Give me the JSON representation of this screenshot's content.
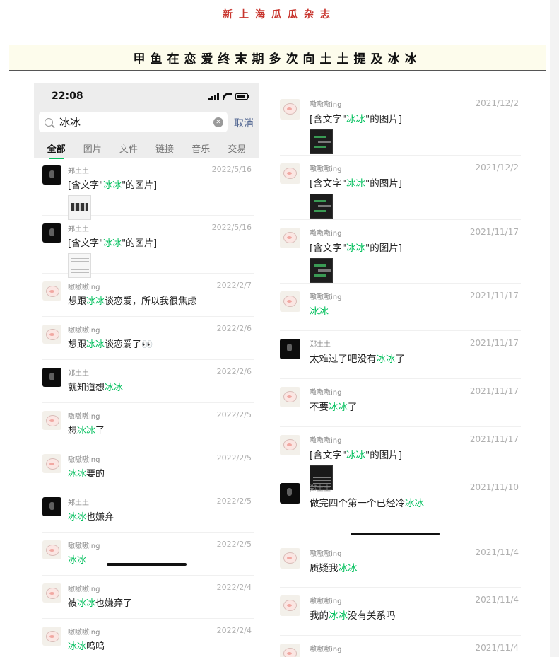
{
  "magazine": {
    "title": "新上海瓜瓜杂志",
    "headline": "甲鱼在恋爱终末期多次向土土提及冰冰"
  },
  "status_bar": {
    "time": "22:08"
  },
  "search": {
    "query": "冰冰",
    "cancel_label": "取消"
  },
  "tabs": [
    {
      "label": "全部",
      "active": true
    },
    {
      "label": "图片",
      "active": false
    },
    {
      "label": "文件",
      "active": false
    },
    {
      "label": "链接",
      "active": false
    },
    {
      "label": "音乐",
      "active": false
    },
    {
      "label": "交易",
      "active": false
    }
  ],
  "left_results": [
    {
      "sender": "郑土土",
      "date": "2022/5/16",
      "avatar": "dark",
      "parts": [
        "[含文字\"",
        "冰冰",
        "\"的图片]"
      ],
      "thumb": "light"
    },
    {
      "sender": "郑土土",
      "date": "2022/5/16",
      "avatar": "dark",
      "parts": [
        "[含文字\"",
        "冰冰",
        "\"的图片]"
      ],
      "thumb": "doc"
    },
    {
      "sender": "嗷嗷嗷ing",
      "date": "2022/2/7",
      "avatar": "pig",
      "parts": [
        "想跟",
        "冰冰",
        "谈恋爱，所以我很焦虑"
      ]
    },
    {
      "sender": "嗷嗷嗷ing",
      "date": "2022/2/6",
      "avatar": "pig",
      "parts": [
        "想跟",
        "冰冰",
        "谈恋爱了👀"
      ]
    },
    {
      "sender": "郑土土",
      "date": "2022/2/6",
      "avatar": "dark",
      "parts": [
        "就知道想",
        "冰冰",
        ""
      ]
    },
    {
      "sender": "嗷嗷嗷ing",
      "date": "2022/2/5",
      "avatar": "pig",
      "parts": [
        "想",
        "冰冰",
        "了"
      ]
    },
    {
      "sender": "嗷嗷嗷ing",
      "date": "2022/2/5",
      "avatar": "pig",
      "parts": [
        "",
        "冰冰",
        "要的"
      ]
    },
    {
      "sender": "郑土土",
      "date": "2022/2/5",
      "avatar": "dark",
      "parts": [
        "",
        "冰冰",
        "也嫌弃"
      ]
    },
    {
      "sender": "嗷嗷嗷ing",
      "date": "2022/2/5",
      "avatar": "pig",
      "parts": [
        "",
        "冰冰",
        ""
      ]
    },
    {
      "sender": "嗷嗷嗷ing",
      "date": "2022/2/4",
      "avatar": "pig",
      "parts": [
        "被",
        "冰冰",
        "也嫌弃了"
      ]
    },
    {
      "sender": "嗷嗷嗷ing",
      "date": "2022/2/4",
      "avatar": "pig",
      "parts": [
        "",
        "冰冰",
        "呜呜"
      ]
    }
  ],
  "right_results": [
    {
      "sender": "嗷嗷嗷ing",
      "date": "2021/12/2",
      "avatar": "pig",
      "parts": [
        "[含文字\"",
        "冰冰",
        "\"的图片]"
      ],
      "thumb": "darkchat"
    },
    {
      "sender": "嗷嗷嗷ing",
      "date": "2021/12/2",
      "avatar": "pig",
      "parts": [
        "[含文字\"",
        "冰冰",
        "\"的图片]"
      ],
      "thumb": "darkchat"
    },
    {
      "sender": "嗷嗷嗷ing",
      "date": "2021/11/17",
      "avatar": "pig",
      "parts": [
        "[含文字\"",
        "冰冰",
        "\"的图片]"
      ],
      "thumb": "darkchat"
    },
    {
      "sender": "嗷嗷嗷ing",
      "date": "2021/11/17",
      "avatar": "pig",
      "parts": [
        "",
        "冰冰",
        ""
      ]
    },
    {
      "sender": "郑土土",
      "date": "2021/11/17",
      "avatar": "dark",
      "parts": [
        "太难过了吧没有",
        "冰冰",
        "了"
      ]
    },
    {
      "sender": "嗷嗷嗷ing",
      "date": "2021/11/17",
      "avatar": "pig",
      "parts": [
        "不要",
        "冰冰",
        "了"
      ]
    },
    {
      "sender": "嗷嗷嗷ing",
      "date": "2021/11/17",
      "avatar": "pig",
      "parts": [
        "[含文字\"",
        "冰冰",
        "\"的图片]"
      ],
      "thumb": "darktext"
    },
    {
      "sender": "郑土土",
      "date": "2021/11/10",
      "avatar": "dark",
      "parts": [
        "做完四个第一个已经冷",
        "冰冰",
        ""
      ]
    },
    {
      "sender": "嗷嗷嗷ing",
      "date": "2021/11/4",
      "avatar": "pig",
      "parts": [
        "质疑我",
        "冰冰",
        ""
      ]
    },
    {
      "sender": "嗷嗷嗷ing",
      "date": "2021/11/4",
      "avatar": "pig",
      "parts": [
        "我的",
        "冰冰",
        "没有关系吗"
      ]
    },
    {
      "sender": "嗷嗷嗷ing",
      "date": "2021/11/4",
      "avatar": "pig",
      "parts": [
        "",
        "",
        ""
      ]
    }
  ],
  "colors": {
    "highlight": "#07c160",
    "cancel": "#576b95",
    "title_red": "#c8352e",
    "headline_bg": "#fdfcec"
  },
  "icons": {
    "search": "search-icon",
    "clear": "clear-icon"
  }
}
